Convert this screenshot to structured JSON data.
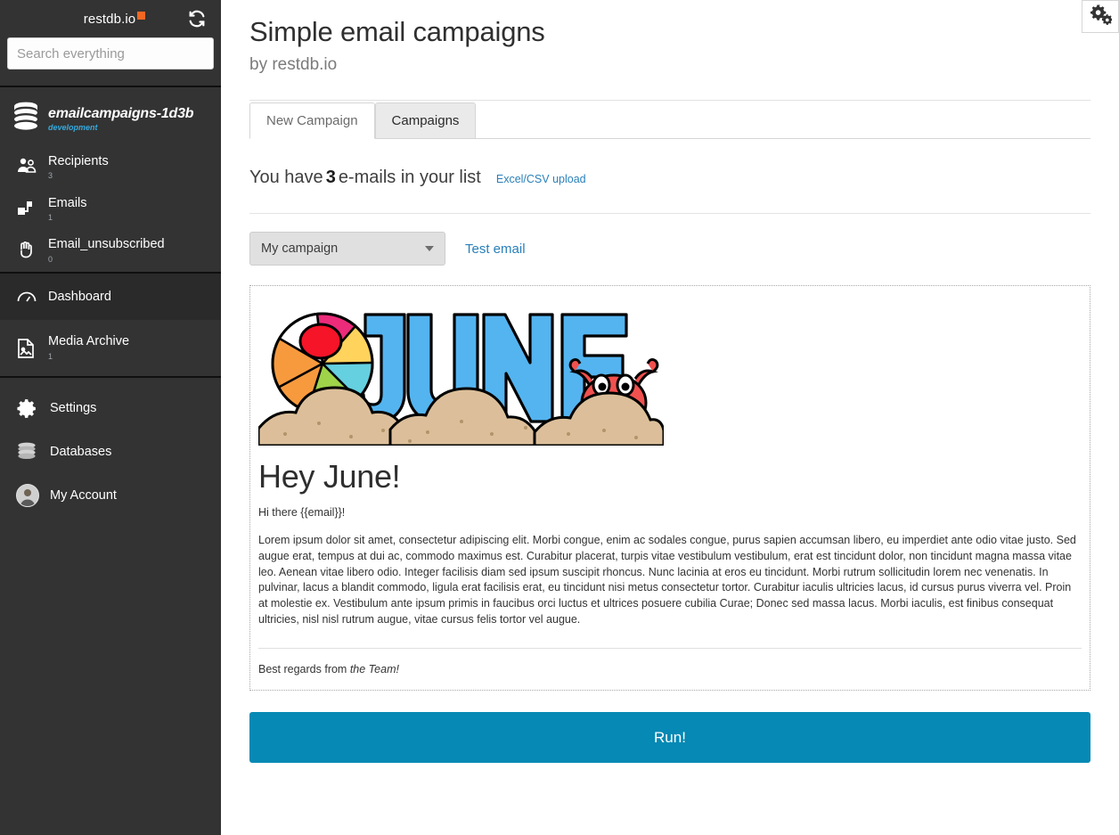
{
  "sidebar": {
    "brand": {
      "logo_text": "restdb.io",
      "refresh_icon": "refresh-icon"
    },
    "search": {
      "placeholder": "Search everything",
      "value": ""
    },
    "database": {
      "name": "emailcampaigns-1d3b",
      "environment": "development",
      "icon": "database-icon"
    },
    "collections": [
      {
        "label": "Recipients",
        "count": "3",
        "icon": "recipients-icon"
      },
      {
        "label": "Emails",
        "count": "1",
        "icon": "emails-icon"
      },
      {
        "label": "Email_unsubscribed",
        "count": "0",
        "icon": "hand-stop-icon"
      }
    ],
    "nav": [
      {
        "label": "Dashboard",
        "count": "",
        "icon": "dashboard-icon",
        "active": true
      },
      {
        "label": "Media Archive",
        "count": "1",
        "icon": "media-archive-icon",
        "active": false
      }
    ],
    "footer": [
      {
        "label": "Settings",
        "icon": "gear-icon"
      },
      {
        "label": "Databases",
        "icon": "database-icon"
      },
      {
        "label": "My Account",
        "icon": "avatar-icon"
      }
    ]
  },
  "header": {
    "title": "Simple email campaigns",
    "subtitle": "by restdb.io",
    "settings_icon": "cogs-icon"
  },
  "tabs": [
    {
      "label": "New Campaign",
      "active": true
    },
    {
      "label": "Campaigns",
      "active": false
    }
  ],
  "summary": {
    "prefix": "You have",
    "count": "3",
    "suffix": "e-mails in your list",
    "upload_link": "Excel/CSV upload"
  },
  "toolbar": {
    "campaign_select_value": "My campaign",
    "campaign_select_options": [
      "My campaign"
    ],
    "test_email_link": "Test email"
  },
  "preview": {
    "banner_alt": "JUNE beach banner with beach ball, sand and crab",
    "heading": "Hey June!",
    "greeting": "Hi there {{email}}!",
    "body": "Lorem ipsum dolor sit amet, consectetur adipiscing elit. Morbi congue, enim ac sodales congue, purus sapien accumsan libero, eu imperdiet ante odio vitae justo. Sed augue erat, tempus at dui ac, commodo maximus est. Curabitur placerat, turpis vitae vestibulum vestibulum, erat est tincidunt dolor, non tincidunt magna massa vitae leo. Aenean vitae libero odio. Integer facilisis diam sed ipsum suscipit rhoncus. Nunc lacinia at eros eu tincidunt. Morbi rutrum sollicitudin lorem nec venenatis. In pulvinar, lacus a blandit commodo, ligula erat facilisis erat, eu tincidunt nisi metus consectetur tortor. Curabitur iaculis ultricies lacus, id cursus purus viverra vel. Proin at molestie ex. Vestibulum ante ipsum primis in faucibus orci luctus et ultrices posuere cubilia Curae; Donec sed massa lacus. Morbi iaculis, est finibus consequat ultricies, nisl nisl rutrum augue, vitae cursus felis tortor vel augue.",
    "signoff_prefix": "Best regards from ",
    "signoff_emphasis": "the Team!"
  },
  "actions": {
    "run_label": "Run!"
  },
  "colors": {
    "sidebar_bg": "#333333",
    "sidebar_active": "#2a2a2a",
    "accent_blue": "#0689b4",
    "link_blue": "#2980b9",
    "env_blue": "#36a9dd",
    "logo_orange": "#f26722"
  }
}
